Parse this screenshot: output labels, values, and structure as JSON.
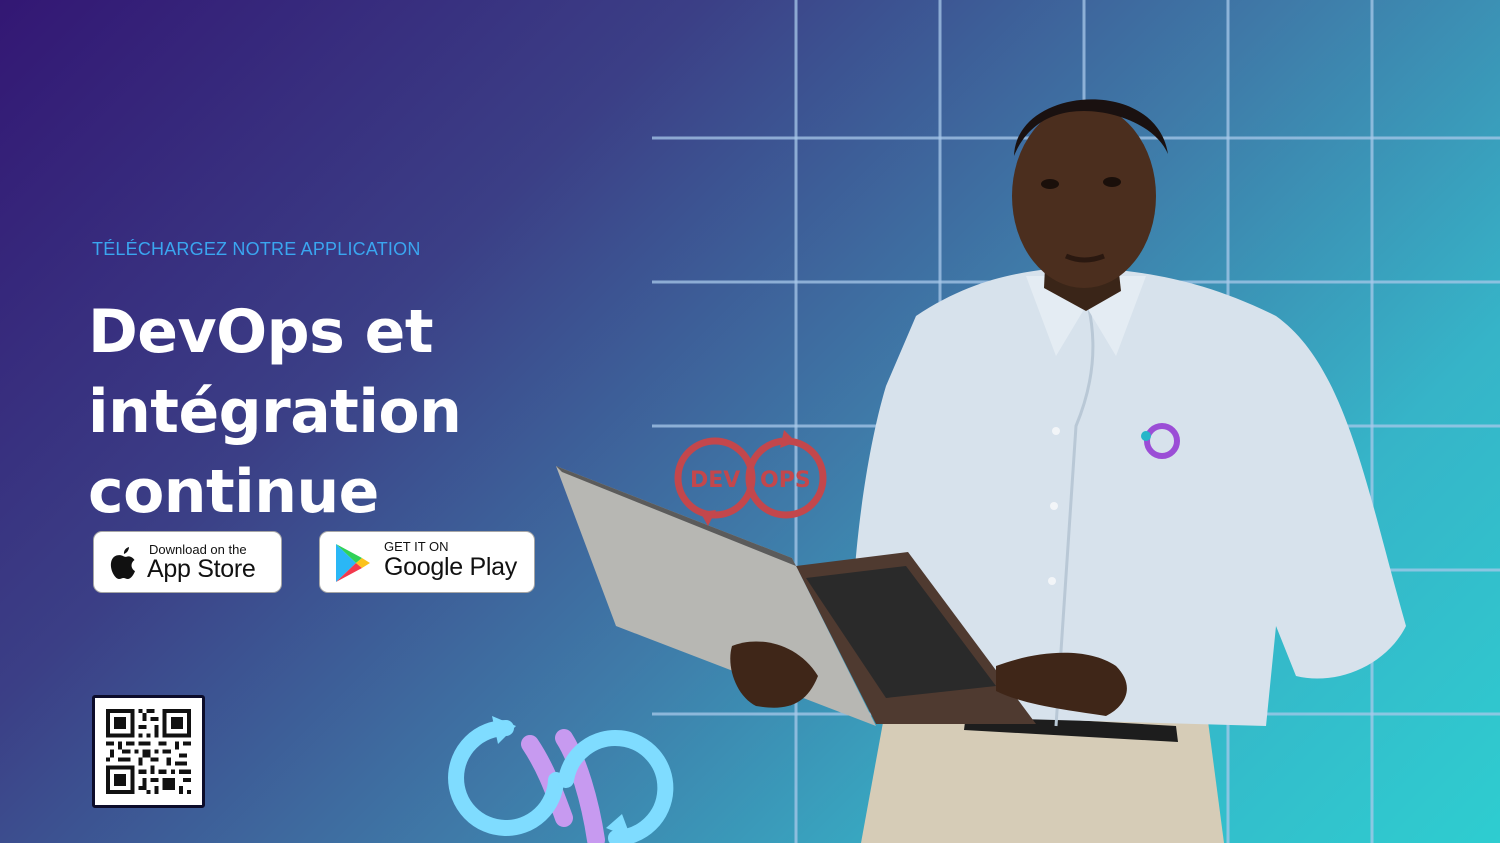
{
  "promo": {
    "eyebrow": "TÉLÉCHARGEZ NOTRE APPLICATION",
    "headline_line1": "DevOps et intégration",
    "headline_line2": "continue"
  },
  "stores": {
    "app_store": {
      "small": "Download on the",
      "big": "App Store",
      "icon": "apple-icon"
    },
    "google_play": {
      "small": "GET IT ON",
      "big": "Google Play",
      "icon": "google-play-icon"
    }
  },
  "devops_logo": {
    "left": "DEV",
    "right": "OPS"
  },
  "qr_code": {
    "icon": "qr-code"
  },
  "colors": {
    "eyebrow": "#3aa6f0",
    "headline": "#ffffff",
    "devops_logo": "#c3474c",
    "loop_light_blue": "#7fdcff",
    "loop_purple": "#c79af0",
    "shirt_logo_purple": "#9b4ed6",
    "shirt_logo_teal": "#27b6c9"
  }
}
